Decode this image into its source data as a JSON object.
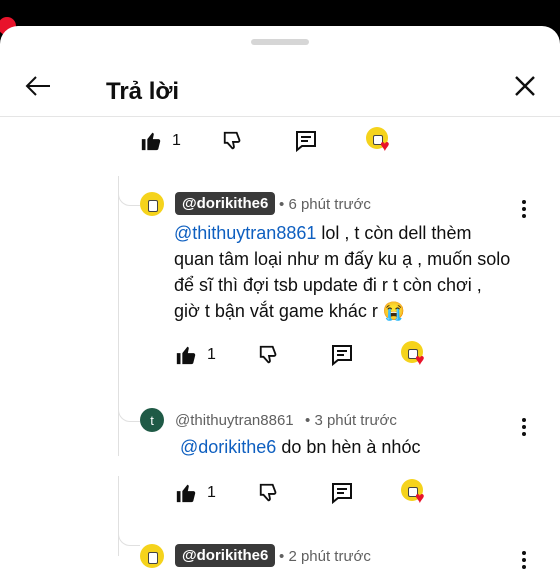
{
  "header": {
    "title": "Trả lời",
    "back_icon": "arrow-left-icon",
    "close_icon": "close-icon"
  },
  "top_actions": {
    "like_count": "1"
  },
  "comments": [
    {
      "author": "@dorikithe6",
      "time": "6 phút trước",
      "mention": "@thithuytran8861",
      "lines": [
        " lol , t còn dell thèm",
        "quan tâm loại như m đấy ku ạ , muốn solo",
        "để sĩ thì đợi tsb update đi r t còn chơi ,",
        "giờ t bận vắt game khác r 😭"
      ],
      "like_count": "1"
    },
    {
      "author": "@thithuytran8861",
      "avatar_letter": "t",
      "time": "3 phút trước",
      "mention": "@dorikithe6",
      "text": " do bn hèn à nhóc",
      "like_count": "1"
    },
    {
      "author": "@dorikithe6",
      "time": "2 phút trước"
    }
  ],
  "meta_sep": "•",
  "colors": {
    "mention": "#0e5fc0",
    "heart": "#e8132b",
    "avatar_green": "#1f5a46"
  }
}
